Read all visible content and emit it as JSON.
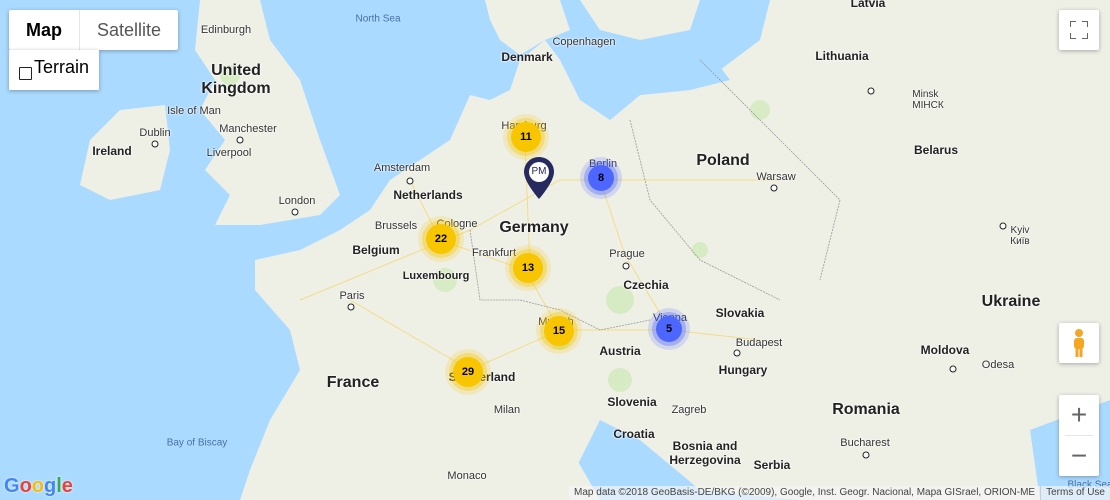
{
  "map_type": {
    "map": "Map",
    "satellite": "Satellite",
    "terrain": "Terrain",
    "terrain_checked": false
  },
  "labels": [
    "North Sea",
    "Latvia",
    "Edinburgh",
    "Denmark",
    "Copenhagen",
    "Lithuania",
    "United Kingdom",
    "Isle of Man",
    "Dublin",
    "Manchester",
    "Ireland",
    "Liverpool",
    "Hamburg",
    "Berlin",
    "Poland",
    "МІНСК",
    "Belarus",
    "Amsterdam",
    "Netherlands",
    "Warsaw",
    "London",
    "Germany",
    "Brussels",
    "Cologne",
    "Belgium",
    "Frankfurt",
    "Prague",
    "Київ",
    "Luxembourg",
    "Czechia",
    "Paris",
    "Ukraine",
    "Munich",
    "Vienna",
    "Slovakia",
    "Austria",
    "Budapest",
    "Moldova",
    "Hungary",
    "Odesa",
    "France",
    "Switzerland",
    "Milan",
    "Slovenia",
    "Zagreb",
    "Romania",
    "Croatia",
    "Bay of Biscay",
    "Bosnia and Herzegovina",
    "Bucharest",
    "Serbia",
    "Monaco",
    "Minsk",
    "Kyiv",
    "Black Sea"
  ],
  "clusters": [
    {
      "count": "11",
      "color": "yellow"
    },
    {
      "count": "8",
      "color": "blue"
    },
    {
      "count": "22",
      "color": "yellow"
    },
    {
      "count": "13",
      "color": "yellow"
    },
    {
      "count": "15",
      "color": "yellow"
    },
    {
      "count": "5",
      "color": "blue"
    },
    {
      "count": "29",
      "color": "yellow"
    }
  ],
  "marker": {
    "label": "PM",
    "color": "#262a5e"
  },
  "colors": {
    "sea": "#aadaff",
    "land": "#eef0e6",
    "cluster_yellow": "#f7c600",
    "cluster_blue": "#4c66ff"
  },
  "controls": {
    "fullscreen": "fullscreen-icon",
    "pegman": "pegman-icon",
    "zoom_in": "+",
    "zoom_out": "−"
  },
  "logo": "Google",
  "attribution": "Map data ©2018 GeoBasis-DE/BKG (©2009), Google, Inst. Geogr. Nacional, Mapa GISrael, ORION-ME",
  "terms": "Terms of Use"
}
